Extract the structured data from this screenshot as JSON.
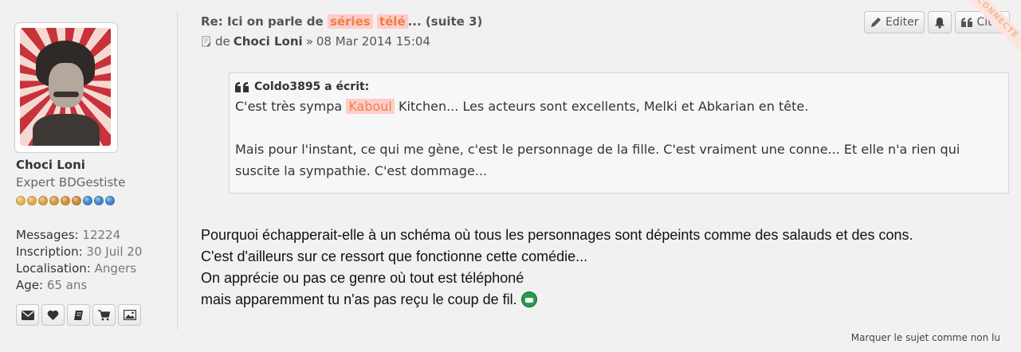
{
  "post": {
    "title_prefix": "Re: Ici on parle de",
    "title_hl1": "séries",
    "title_hl2": "télé",
    "title_suffix": "... (suite 3)",
    "meta_de": "de",
    "author": "Choci Loni",
    "meta_sep": "»",
    "date": "08 Mar 2014 15:04",
    "actions": {
      "edit": "Editer",
      "quote": "Citer"
    },
    "corner_label": "CONNECTÉ"
  },
  "profile": {
    "username": "Choci Loni",
    "rank": "Expert BDGestiste",
    "rank_dots": [
      "#e6b24a",
      "#e0a845",
      "#daa040",
      "#d4983c",
      "#cf9038",
      "#c98834",
      "#3f86c9",
      "#3f86c9",
      "#3f86c9"
    ],
    "stats": [
      {
        "label": "Messages:",
        "value": "12224"
      },
      {
        "label": "Inscription:",
        "value": "30 Juil 20"
      },
      {
        "label": "Localisation:",
        "value": "Angers"
      },
      {
        "label": "Age:",
        "value": "65 ans"
      }
    ],
    "contact_icons": [
      "envelope-icon",
      "heart-icon",
      "book-icon",
      "cart-icon",
      "image-icon"
    ]
  },
  "quote": {
    "author": "Coldo3895 a écrit:",
    "line1_pre": "C'est très sympa",
    "line1_hl": "Kaboul",
    "line1_post": "Kitchen... Les acteurs sont excellents, Melki et Abkarian en tête.",
    "para2": "Mais pour l'instant, ce qui me gène, c'est le personnage de la fille. C'est vraiment une conne... Et elle n'a rien qui suscite la sympathie. C'est dommage..."
  },
  "body": {
    "lines": [
      "Pourquoi échapperait-elle à un schéma où tous les personnages sont dépeints comme des salauds et des cons.",
      "C'est d'ailleurs sur ce ressort que fonctionne cette comédie...",
      "On apprécie ou pas ce genre où tout est téléphoné",
      "mais apparemment tu n'as pas reçu le coup de fil."
    ]
  },
  "footer": {
    "mark_unread": "Marquer le sujet comme non lu"
  },
  "colors": {
    "highlight_bg": "#ffcccc",
    "highlight_fg": "#f08040",
    "rank_blue": "#3f86c9"
  }
}
